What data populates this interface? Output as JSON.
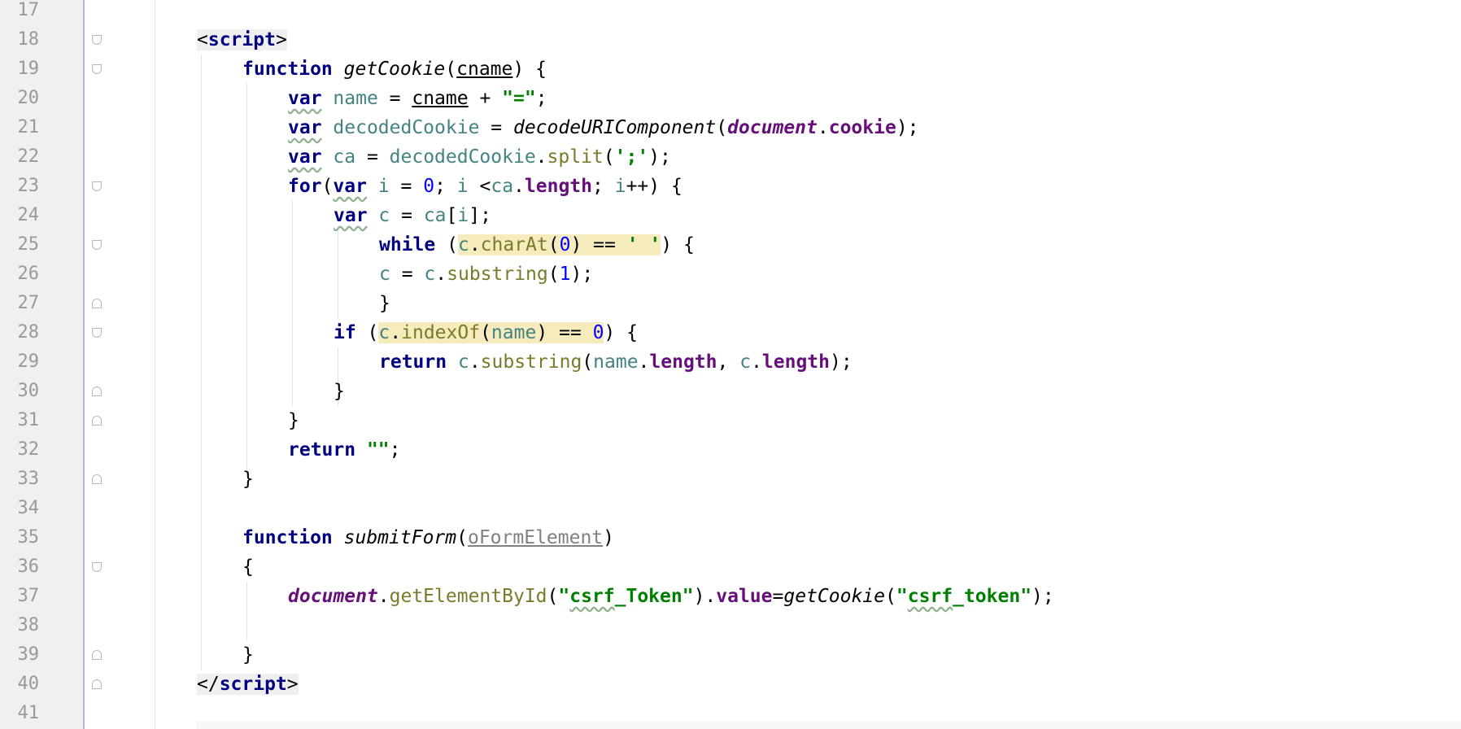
{
  "editor": {
    "line_numbers": [
      "17",
      "18",
      "19",
      "20",
      "21",
      "22",
      "23",
      "24",
      "25",
      "26",
      "27",
      "28",
      "29",
      "30",
      "31",
      "32",
      "33",
      "34",
      "35",
      "36",
      "37",
      "38",
      "39",
      "40",
      "41"
    ],
    "lines": {
      "l18": {
        "t1": "<",
        "t2": "script",
        "t3": ">"
      },
      "l19": {
        "kw": "function",
        "name": "getCookie",
        "p1": "(",
        "param": "cname",
        "p2": ") {"
      },
      "l20": {
        "kw": "var",
        "a": " ",
        "v": "name",
        "b": " = ",
        "param": "cname",
        "c": " + ",
        "s": "\"=\"",
        "d": ";"
      },
      "l21": {
        "kw": "var",
        "a": " ",
        "v": "decodedCookie",
        "b": " = ",
        "f": "decodeURIComponent",
        "c": "(",
        "g": "document",
        "d": ".",
        "p": "cookie",
        "e": ");"
      },
      "l22": {
        "kw": "var",
        "a": " ",
        "v": "ca",
        "b": " = ",
        "v2": "decodedCookie",
        "c": ".",
        "m": "split",
        "d": "(",
        "s": "';'",
        "e": ");"
      },
      "l23": {
        "kw1": "for",
        "a": "(",
        "kw2": "var",
        "b": " ",
        "v": "i",
        "c": " = ",
        "n": "0",
        "d": "; ",
        "v2": "i",
        "e": " <",
        "v3": "ca",
        "f": ".",
        "p": "length",
        "g": "; ",
        "v4": "i",
        "h": "++) {"
      },
      "l24": {
        "kw": "var",
        "a": " ",
        "v": "c",
        "b": " = ",
        "v2": "ca",
        "c": "[",
        "v3": "i",
        "d": "];"
      },
      "l25": {
        "kw": "while",
        "a": " (",
        "v": "c",
        "b": ".",
        "m": "charAt",
        "c": "(",
        "n": "0",
        "d": ") == ",
        "s": "' '",
        "e": ") {"
      },
      "l26": {
        "v": "c",
        "a": " = ",
        "v2": "c",
        "b": ".",
        "m": "substring",
        "c": "(",
        "n": "1",
        "d": ");"
      },
      "l27": {
        "t": "}"
      },
      "l28": {
        "kw": "if",
        "a": " (",
        "v": "c",
        "b": ".",
        "m": "indexOf",
        "c": "(",
        "v2": "name",
        "d": ") == ",
        "n": "0",
        "e": ") {"
      },
      "l29": {
        "kw": "return",
        "a": " ",
        "v": "c",
        "b": ".",
        "m": "substring",
        "c": "(",
        "v2": "name",
        "d": ".",
        "p": "length",
        "e": ", ",
        "v3": "c",
        "f": ".",
        "p2": "length",
        "g": ");"
      },
      "l30": {
        "t": "}"
      },
      "l31": {
        "t": "}"
      },
      "l32": {
        "kw": "return",
        "a": " ",
        "s": "\"\"",
        "b": ";"
      },
      "l33": {
        "t": "}"
      },
      "l35": {
        "kw": "function",
        "name": "submitForm",
        "a": "(",
        "param": "oFormElement",
        "b": ")"
      },
      "l36": {
        "t": "{"
      },
      "l37": {
        "g": "document",
        "a": ".",
        "m": "getElementById",
        "b": "(",
        "s1q": "\"",
        "s1a": "csrf",
        "s1b": "_Token\"",
        "c": ").",
        "p": "value",
        "d": "=",
        "f": "getCookie",
        "e": "(",
        "s2q": "\"",
        "s2a": "csrf",
        "s2b": "_token\"",
        "h": ");"
      },
      "l39": {
        "t": "}"
      },
      "l40": {
        "t1": "</",
        "t2": "script",
        "t3": ">"
      }
    }
  }
}
